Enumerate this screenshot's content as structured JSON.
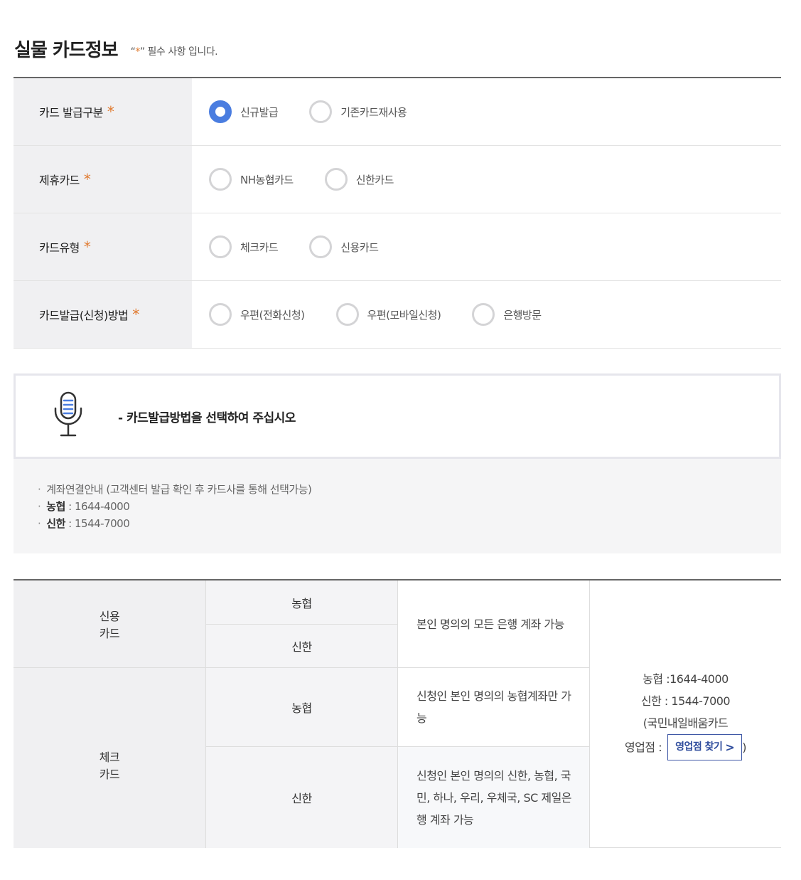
{
  "header": {
    "title": "실물 카드정보",
    "note_open": "“",
    "note_star": "*",
    "note_close": "” 필수 사항 입니다."
  },
  "form": {
    "rows": [
      {
        "label": "카드 발급구분",
        "star": "*",
        "options": [
          "신규발급",
          "기존카드재사용"
        ],
        "selected": 0
      },
      {
        "label": "제휴카드",
        "star": "*",
        "options": [
          "NH농협카드",
          "신한카드"
        ],
        "selected": null
      },
      {
        "label": "카드유형",
        "star": "*",
        "options": [
          "체크카드",
          "신용카드"
        ],
        "selected": null
      },
      {
        "label": "카드발급(신청)방법",
        "star": "*",
        "options": [
          "우편(전화신청)",
          "우편(모바일신청)",
          "은행방문"
        ],
        "selected": null
      }
    ]
  },
  "notice": {
    "icon": "microphone-icon",
    "message": "- 카드발급방법을 선택하여 주십시오"
  },
  "info": {
    "line1": "계좌연결안내 (고객센터 발급 확인 후 카드사를 통해 선택가능)",
    "line2_bold": "농협",
    "line2_rest": " : 1644-4000",
    "line3_bold": "신한",
    "line3_rest": " : 1544-7000"
  },
  "table": {
    "credit_label": [
      "신용",
      "카드"
    ],
    "check_label": [
      "체크",
      "카드"
    ],
    "credit_nh": "농협",
    "credit_sh": "신한",
    "credit_desc": "본인 명의의 모든 은행 계좌 가능",
    "check_nh": "농협",
    "check_nh_desc": "신청인 본인 명의의 농협계좌만 가능",
    "check_sh": "신한",
    "check_sh_desc": "신청인 본인 명의의 신한, 농협, 국민, 하나, 우리, 우체국, SC 제일은행 계좌 가능",
    "contact_nh": "농협 :1644-4000",
    "contact_sh": "신한 : 1544-7000",
    "contact_note": "(국민내일배움카드",
    "branch_label": "영업점 :",
    "branch_button": "영업점 찾기",
    "branch_close": ")"
  },
  "colors": {
    "accent": "#4a7de0",
    "star": "#e0792e",
    "button": "#2d4b9c"
  }
}
